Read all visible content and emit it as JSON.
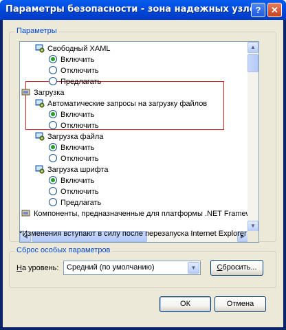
{
  "window": {
    "title": "Параметры безопасности - зона надежных узлов",
    "help_glyph": "?",
    "close_glyph": "✕"
  },
  "settings": {
    "legend": "Параметры",
    "rows": [
      {
        "kind": "item",
        "label": "Свободный XAML"
      },
      {
        "kind": "radio",
        "label": "Включить",
        "checked": true
      },
      {
        "kind": "radio",
        "label": "Отключить",
        "checked": false
      },
      {
        "kind": "radio",
        "label": "Предлагать",
        "checked": false
      },
      {
        "kind": "category",
        "label": "Загрузка"
      },
      {
        "kind": "item",
        "label": "Автоматические запросы на загрузку файлов"
      },
      {
        "kind": "radio",
        "label": "Включить",
        "checked": true
      },
      {
        "kind": "radio",
        "label": "Отключить",
        "checked": false
      },
      {
        "kind": "item",
        "label": "Загрузка файла"
      },
      {
        "kind": "radio",
        "label": "Включить",
        "checked": true
      },
      {
        "kind": "radio",
        "label": "Отключить",
        "checked": false
      },
      {
        "kind": "item",
        "label": "Загрузка шрифта"
      },
      {
        "kind": "radio",
        "label": "Включить",
        "checked": true
      },
      {
        "kind": "radio",
        "label": "Отключить",
        "checked": false
      },
      {
        "kind": "radio",
        "label": "Предлагать",
        "checked": false
      },
      {
        "kind": "category",
        "label": "Компоненты, предназначенные для платформы .NET Framew"
      }
    ],
    "note": "*Изменения вступают в силу после перезапуска Internet Explorer"
  },
  "reset": {
    "legend": "Сброс особых параметров",
    "level_label_prefix": "Н",
    "level_label_rest": "а уровень:",
    "level_value": "Средний (по умолчанию)",
    "reset_button_prefix": "С",
    "reset_button_rest": "бросить..."
  },
  "dialog": {
    "ok_label": "ОК",
    "cancel_label": "Отмена"
  },
  "colors": {
    "accent": "#0046d5",
    "highlight": "#d42020",
    "radio_dot": "#21a121"
  }
}
